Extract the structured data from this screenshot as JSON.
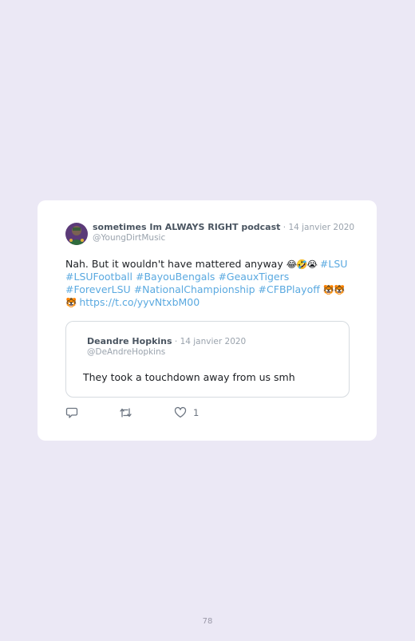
{
  "tweet": {
    "author_name": "sometimes Im ALWAYS RIGHT podcast",
    "separator": " · ",
    "date": "14 janvier 2020",
    "handle": "@YoungDirtMusic",
    "body_text": "Nah. But it wouldn't have mattered anyway ",
    "emojis_1": "😂🤣😭",
    "hashtags": [
      "#LSU",
      "#LSUFootball",
      "#BayouBengals",
      "#GeauxTigers",
      "#ForeverLSU",
      "#NationalChampionship",
      "#CFBPlayoff"
    ],
    "emojis_2": "🐯🐯🐯",
    "url": "https://t.co/yyvNtxbM00"
  },
  "quoted_tweet": {
    "author_name": "Deandre Hopkins",
    "separator": " · ",
    "date": "14 janvier 2020",
    "handle": "@DeAndreHopkins",
    "text": "They took a touchdown away from us smh"
  },
  "actions": {
    "like_count": "1"
  },
  "page": {
    "number": "78"
  },
  "icons": {
    "reply": "reply-icon",
    "retweet": "retweet-icon",
    "like": "heart-icon"
  },
  "colors": {
    "background": "#ebe8f5",
    "link": "#5aa9e0",
    "muted": "#9aa3ad"
  }
}
